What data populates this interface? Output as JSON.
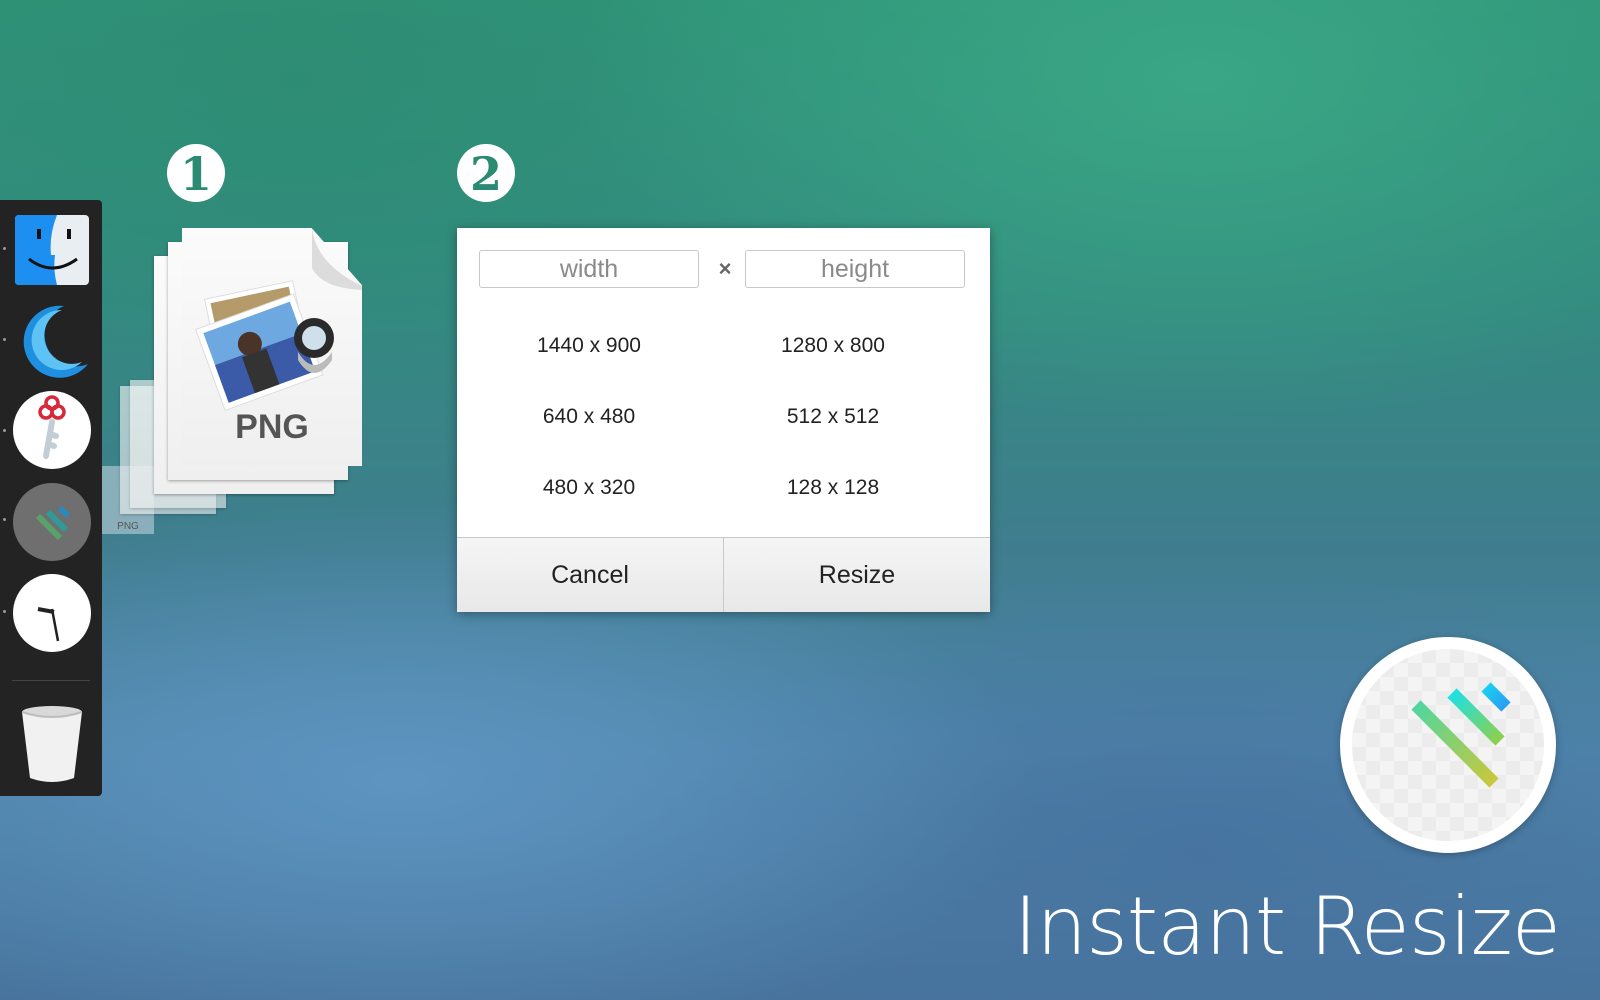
{
  "steps": {
    "step1": "1",
    "step2": "2"
  },
  "dock": {
    "items": [
      {
        "name": "Finder",
        "icon": "finder-icon"
      },
      {
        "name": "Night app",
        "icon": "moon-icon"
      },
      {
        "name": "Keychain",
        "icon": "key-icon"
      },
      {
        "name": "Instant Resize",
        "icon": "instant-resize-icon"
      },
      {
        "name": "Clock",
        "icon": "clock-icon"
      },
      {
        "name": "Trash",
        "icon": "trash-icon"
      }
    ]
  },
  "files": {
    "file_type_label": "PNG",
    "ghost_label": "PNG"
  },
  "dialog": {
    "width_placeholder": "width",
    "height_placeholder": "height",
    "times_symbol": "×",
    "presets": [
      "1440 x 900",
      "1280 x 800",
      "640 x 480",
      "512 x 512",
      "480 x 320",
      "128 x 128"
    ],
    "cancel_label": "Cancel",
    "resize_label": "Resize"
  },
  "brand": {
    "title": "Instant Resize",
    "accent_colors": [
      "#4fd6a0",
      "#1de0e6",
      "#19b8f5",
      "#c9c83a"
    ]
  }
}
